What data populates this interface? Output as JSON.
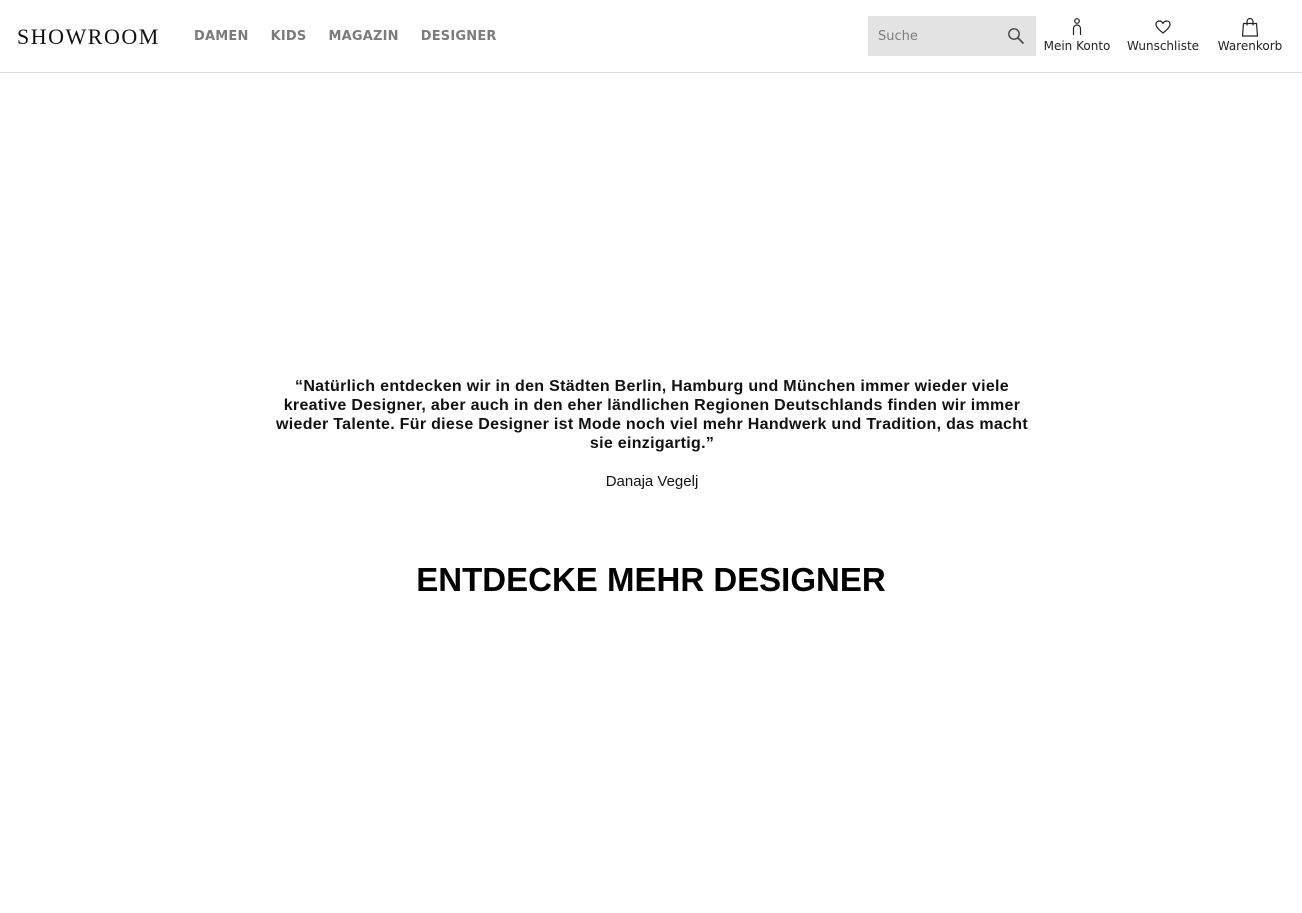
{
  "header": {
    "logo": "SHOWROOM",
    "nav": [
      "DAMEN",
      "KIDS",
      "MAGAZIN",
      "DESIGNER"
    ],
    "search": {
      "placeholder": "Suche",
      "value": ""
    },
    "account_label": "Mein Konto",
    "wishlist_label": "Wunschliste",
    "cart_label": "Warenkorb"
  },
  "icons": {
    "search": "search-icon",
    "account": "person-icon",
    "wishlist": "heart-icon",
    "cart": "shopping-bag-icon"
  },
  "main": {
    "quote": "“Natürlich entdecken wir in den Städten Berlin, Hamburg und München immer wieder viele kreative Designer, aber auch in den eher ländlichen Regionen Deutschlands finden wir immer wieder Talente. Für diese Designer ist Mode noch viel mehr Handwerk und Tradition, das macht sie einzigartig.”",
    "quote_author": "Danaja Vegelj",
    "section_title": "ENTDECKE MEHR DESIGNER"
  },
  "colors": {
    "nav_text": "#7b7b7b",
    "search_bg": "#e3e3e3",
    "header_border": "#dcdcdc"
  }
}
